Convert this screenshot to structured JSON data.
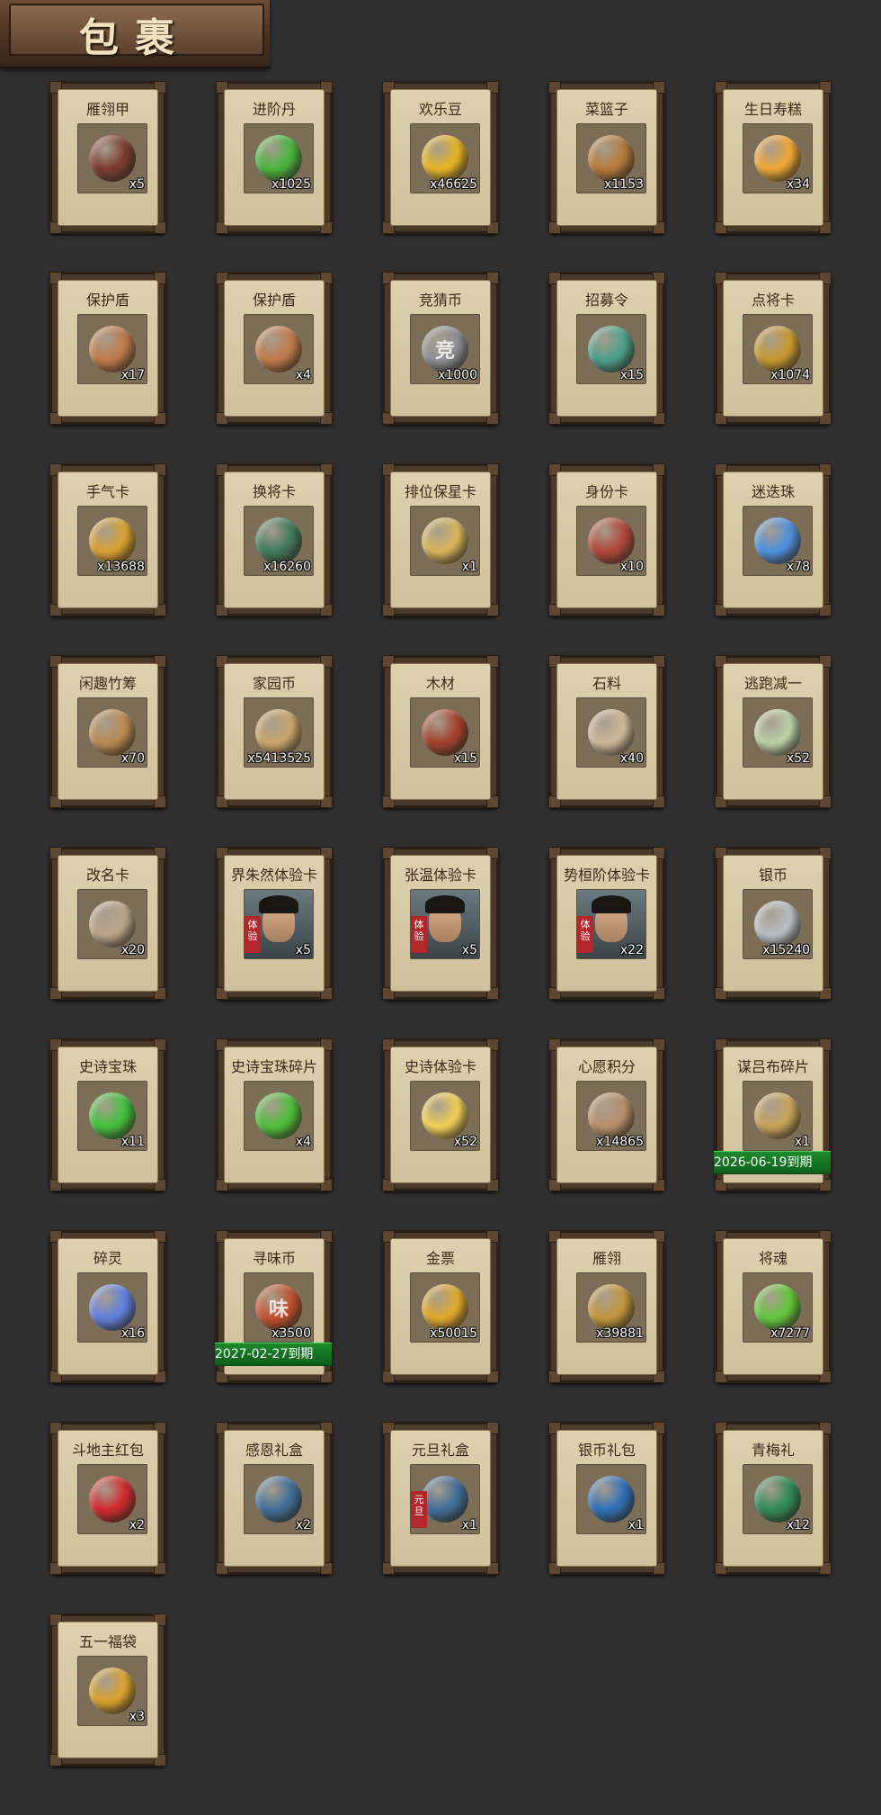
{
  "header": {
    "title": "包裹"
  },
  "items": [
    {
      "name": "雁翎甲",
      "count": "x5",
      "icon": "armor-icon",
      "color": "#7b3b2f"
    },
    {
      "name": "进阶丹",
      "count": "x1025",
      "icon": "green-pill-icon",
      "color": "#48b43b"
    },
    {
      "name": "欢乐豆",
      "count": "x46625",
      "icon": "gold-beans-icon",
      "color": "#e6b522"
    },
    {
      "name": "菜篮子",
      "count": "x1153",
      "icon": "vegetable-basket-icon",
      "color": "#b57a3a"
    },
    {
      "name": "生日寿糕",
      "count": "x34",
      "icon": "birthday-cake-icon",
      "color": "#f0a733"
    },
    {
      "name": "保护盾",
      "count": "x17",
      "icon": "shield-icon",
      "color": "#c07a4a"
    },
    {
      "name": "保护盾",
      "count": "x4",
      "icon": "shield-icon",
      "color": "#c07a4a"
    },
    {
      "name": "竞猜币",
      "count": "x1000",
      "icon": "silver-coin-icon",
      "color": "#8d8f94",
      "glyph": "竞"
    },
    {
      "name": "招募令",
      "count": "x15",
      "icon": "recruit-token-icon",
      "color": "#4aa08a"
    },
    {
      "name": "点将卡",
      "count": "x1074",
      "icon": "general-card-icon",
      "color": "#c7992f"
    },
    {
      "name": "手气卡",
      "count": "x13688",
      "icon": "luck-card-icon",
      "color": "#d9a230"
    },
    {
      "name": "换将卡",
      "count": "x16260",
      "icon": "swap-general-card-icon",
      "color": "#3f7a5a"
    },
    {
      "name": "排位保星卡",
      "count": "x1",
      "icon": "rank-star-card-icon",
      "color": "#d8b45a"
    },
    {
      "name": "身份卡",
      "count": "x10",
      "icon": "identity-card-icon",
      "color": "#b2463a"
    },
    {
      "name": "迷迭珠",
      "count": "x78",
      "icon": "blue-orb-icon",
      "color": "#4d8fe0"
    },
    {
      "name": "闲趣竹筹",
      "count": "x70",
      "icon": "bamboo-token-icon",
      "color": "#b98a52"
    },
    {
      "name": "家园币",
      "count": "x5413525",
      "icon": "home-coin-icon",
      "color": "#c9a56b"
    },
    {
      "name": "木材",
      "count": "x15",
      "icon": "wood-icon",
      "color": "#a3402c"
    },
    {
      "name": "石料",
      "count": "x40",
      "icon": "stone-icon",
      "color": "#cdb79a"
    },
    {
      "name": "逃跑减一",
      "count": "x52",
      "icon": "jade-tag-icon",
      "color": "#b9d0a8"
    },
    {
      "name": "改名卡",
      "count": "x20",
      "icon": "rename-card-icon",
      "color": "#bba58b"
    },
    {
      "name": "界朱然体验卡",
      "count": "x5",
      "icon": "portrait-icon",
      "color": "#6d7a80",
      "portrait": true,
      "stamp": "体验"
    },
    {
      "name": "张温体验卡",
      "count": "x5",
      "icon": "portrait-icon",
      "color": "#6d7a80",
      "portrait": true,
      "stamp": "体验"
    },
    {
      "name": "势桓阶体验卡",
      "count": "x22",
      "icon": "portrait-icon",
      "color": "#6d7a80",
      "portrait": true,
      "stamp": "体验"
    },
    {
      "name": "银币",
      "count": "x15240",
      "icon": "silver-coins-icon",
      "color": "#b9bec4"
    },
    {
      "name": "史诗宝珠",
      "count": "x11",
      "icon": "green-orb-icon",
      "color": "#3fc23b"
    },
    {
      "name": "史诗宝珠碎片",
      "count": "x4",
      "icon": "green-shard-icon",
      "color": "#4fbf3a"
    },
    {
      "name": "史诗体验卡",
      "count": "x52",
      "icon": "gold-card-icon",
      "color": "#f1cf55"
    },
    {
      "name": "心愿积分",
      "count": "x14865",
      "icon": "heart-coin-icon",
      "color": "#b8906a"
    },
    {
      "name": "谋吕布碎片",
      "count": "x1",
      "icon": "puzzle-piece-icon",
      "color": "#c9a45a",
      "expiry": "2026-06-19到期"
    },
    {
      "name": "碎灵",
      "count": "x16",
      "icon": "crystal-shard-icon",
      "color": "#5f7fe0"
    },
    {
      "name": "寻味币",
      "count": "x3500",
      "icon": "taste-coin-icon",
      "color": "#c1502e",
      "glyph": "味",
      "expiry": "2027-02-27到期"
    },
    {
      "name": "金票",
      "count": "x50015",
      "icon": "gold-ticket-icon",
      "color": "#e0a92a"
    },
    {
      "name": "雁翎",
      "count": "x39881",
      "icon": "feather-icon",
      "color": "#c2973d"
    },
    {
      "name": "将魂",
      "count": "x7277",
      "icon": "green-crystal-icon",
      "color": "#62c83a"
    },
    {
      "name": "斗地主红包",
      "count": "x2",
      "icon": "red-envelope-icon",
      "color": "#d2282c"
    },
    {
      "name": "感恩礼盒",
      "count": "x2",
      "icon": "gift-box-icon",
      "color": "#3e6e9a"
    },
    {
      "name": "元旦礼盒",
      "count": "x1",
      "icon": "gift-box-icon",
      "color": "#3e6e9a",
      "stamp": "元旦"
    },
    {
      "name": "银币礼包",
      "count": "x1",
      "icon": "blue-pouch-icon",
      "color": "#2e6fb8"
    },
    {
      "name": "青梅礼",
      "count": "x12",
      "icon": "green-pouch-icon",
      "color": "#2d8a55"
    },
    {
      "name": "五一福袋",
      "count": "x3",
      "icon": "lucky-bag-icon",
      "color": "#d9a22c"
    }
  ]
}
